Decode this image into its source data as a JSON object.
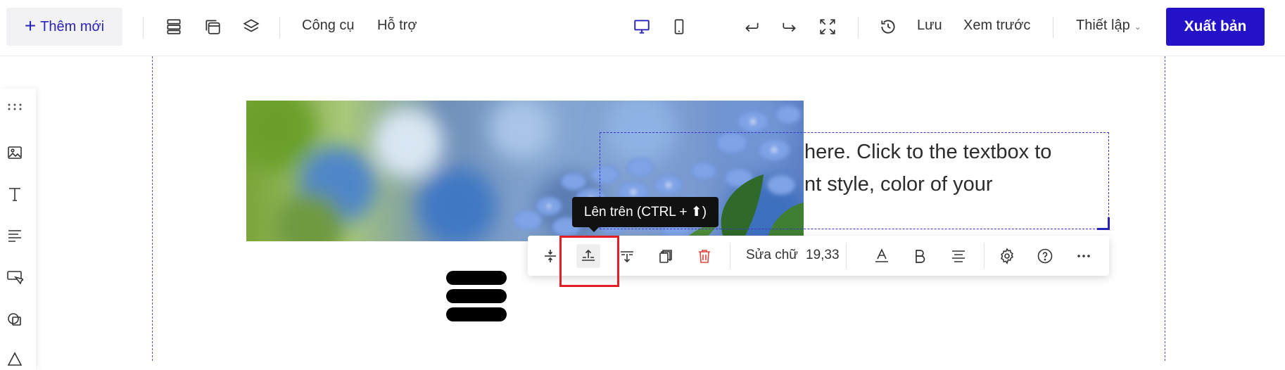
{
  "toolbar": {
    "add_new": "Thêm mới",
    "tools": "Công cụ",
    "support": "Hỗ trợ",
    "save": "Lưu",
    "preview": "Xem trước",
    "settings": "Thiết lập",
    "publish": "Xuất bản",
    "accent_color": "#2412c9",
    "icons": [
      "sections-icon",
      "pages-icon",
      "layers-icon",
      "desktop-icon",
      "mobile-icon",
      "undo-icon",
      "redo-icon",
      "fullscreen-icon",
      "history-icon"
    ]
  },
  "left_tools": {
    "icons": [
      "drag-grip-icon",
      "image-icon",
      "text-icon",
      "paragraph-icon",
      "button-icon",
      "shape-icon",
      "more-icon"
    ]
  },
  "canvas": {
    "text_line_1": "here. Click to the textbox to",
    "text_line_2": "nt style, color of your"
  },
  "element_toolbar": {
    "edit_text": "Sửa chữ",
    "font_size": "19,33",
    "icons": [
      "resize-vertical-icon",
      "move-up-icon",
      "move-down-icon",
      "duplicate-icon",
      "delete-icon",
      "text-color-icon",
      "bold-icon",
      "align-center-icon",
      "gear-icon",
      "help-icon",
      "more-icon"
    ],
    "tooltip": "Lên trên (CTRL + ⬆)",
    "delete_color": "#e0443a",
    "highlight_color": "#e31e24"
  }
}
